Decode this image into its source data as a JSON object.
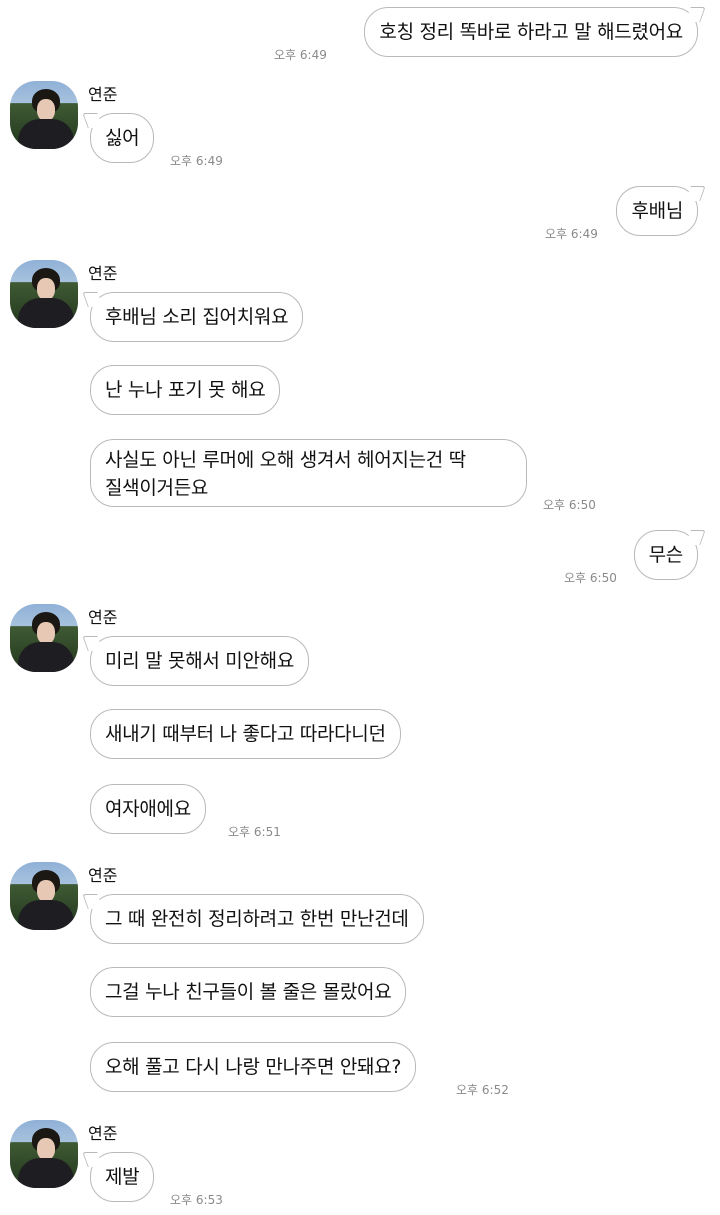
{
  "contact": {
    "name": "연준"
  },
  "messages": {
    "m1": {
      "text": "호칭 정리 똑바로 하라고 말 해드렸어요",
      "time": "오후 6:49"
    },
    "m2": {
      "text": "싫어",
      "time": "오후 6:49"
    },
    "m3": {
      "text": "후배님",
      "time": "오후 6:49"
    },
    "m4": {
      "text": "후배님 소리 집어치워요"
    },
    "m5": {
      "text": "난 누나 포기 못 해요"
    },
    "m6": {
      "line1": "사실도 아닌 루머에 오해 생겨서 헤어지는건 딱",
      "line2": "질색이거든요",
      "time": "오후 6:50"
    },
    "m7": {
      "text": "무슨",
      "time": "오후 6:50"
    },
    "m8": {
      "text": "미리 말 못해서 미안해요"
    },
    "m9": {
      "text": "새내기 때부터 나 좋다고 따라다니던"
    },
    "m10": {
      "text": "여자애에요",
      "time": "오후 6:51"
    },
    "m11": {
      "text": "그 때 완전히 정리하려고 한번 만난건데"
    },
    "m12": {
      "text": "그걸 누나 친구들이 볼 줄은 몰랐어요"
    },
    "m13": {
      "text": "오해 풀고 다시 나랑 만나주면 안돼요?",
      "time": "오후 6:52"
    },
    "m14": {
      "text": "제발",
      "time": "오후 6:53"
    }
  }
}
